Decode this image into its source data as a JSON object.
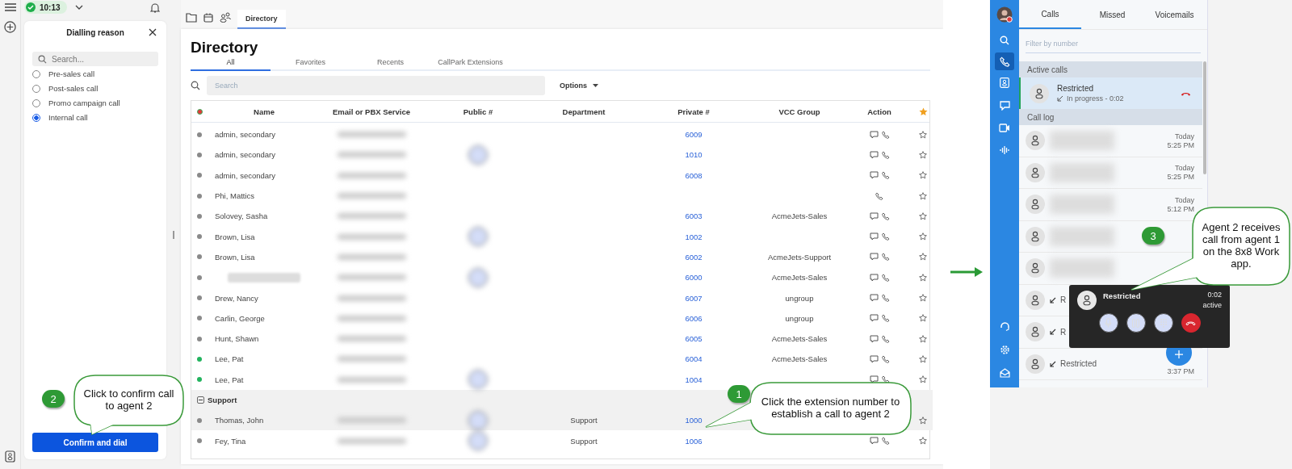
{
  "top_bar": {
    "status_time": "10:13"
  },
  "dialling_panel": {
    "title": "Dialling reason",
    "search": {
      "placeholder": "Search..."
    },
    "options": [
      {
        "label": "Pre-sales call",
        "selected": false
      },
      {
        "label": "Post-sales call",
        "selected": false
      },
      {
        "label": "Promo campaign call",
        "selected": false
      },
      {
        "label": "Internal call",
        "selected": true
      }
    ],
    "confirm_button": "Confirm and dial"
  },
  "directory": {
    "tabs": [
      {
        "label": "Directory",
        "selected": true
      }
    ],
    "title": "Directory",
    "filter_tabs": [
      {
        "label": "All",
        "selected": true
      },
      {
        "label": "Favorites",
        "selected": false
      },
      {
        "label": "Recents",
        "selected": false
      },
      {
        "label": "CallPark Extensions",
        "selected": false
      }
    ],
    "search": {
      "placeholder": "Search"
    },
    "options_button": "Options",
    "table": {
      "columns": [
        "Name",
        "Email or PBX Service",
        "Public #",
        "Department",
        "Private #",
        "VCC Group",
        "Action"
      ],
      "rows": [
        {
          "kind": "contact",
          "name": "admin, secondary",
          "color": "#8a8a8a",
          "email_blurred": true,
          "public_blurred": false,
          "private": "6009",
          "actions": {
            "chat": true,
            "call": true
          },
          "selected": false
        },
        {
          "kind": "contact",
          "name": "admin, secondary",
          "color": "#8a8a8a",
          "email_blurred": true,
          "public_blurred": true,
          "private": "1010",
          "actions": {
            "chat": true,
            "call": true
          },
          "selected": false
        },
        {
          "kind": "contact",
          "name": "admin, secondary",
          "color": "#8a8a8a",
          "email_blurred": true,
          "public_blurred": false,
          "private": "6008",
          "actions": {
            "chat": true,
            "call": true
          },
          "selected": false
        },
        {
          "kind": "contact",
          "name": "Phi, Mattics",
          "color": "#8a8a8a",
          "email_blurred": true,
          "public_blurred": false,
          "actions": {
            "chat": false,
            "call": true
          },
          "selected": false
        },
        {
          "kind": "contact",
          "name": "Solovey, Sasha",
          "color": "#8a8a8a",
          "email_blurred": true,
          "public_blurred": false,
          "private": "6003",
          "vcc_group": "AcmeJets-Sales",
          "actions": {
            "chat": true,
            "call": true
          },
          "selected": false
        },
        {
          "kind": "contact",
          "name": "Brown, Lisa",
          "color": "#8a8a8a",
          "email_blurred": true,
          "public_blurred": true,
          "private": "1002",
          "actions": {
            "chat": true,
            "call": true
          },
          "selected": false
        },
        {
          "kind": "contact",
          "name": "Brown, Lisa",
          "color": "#8a8a8a",
          "email_blurred": true,
          "public_blurred": false,
          "private": "6002",
          "vcc_group": "AcmeJets-Support",
          "actions": {
            "chat": true,
            "call": true
          },
          "selected": false
        },
        {
          "kind": "contact",
          "name_blurred": true,
          "color": "#8a8a8a",
          "email_blurred": true,
          "public_blurred": true,
          "private": "6000",
          "vcc_group": "AcmeJets-Sales",
          "actions": {
            "chat": true,
            "call": true
          },
          "selected": false
        },
        {
          "kind": "contact",
          "name": "Drew, Nancy",
          "color": "#8a8a8a",
          "email_blurred": true,
          "public_blurred": false,
          "private": "6007",
          "vcc_group": "ungroup",
          "actions": {
            "chat": true,
            "call": true
          },
          "selected": false
        },
        {
          "kind": "contact",
          "name": "Carlin, George",
          "color": "#8a8a8a",
          "email_blurred": true,
          "public_blurred": false,
          "private": "6006",
          "vcc_group": "ungroup",
          "actions": {
            "chat": true,
            "call": true
          },
          "selected": false
        },
        {
          "kind": "contact",
          "name": "Hunt, Shawn",
          "color": "#8a8a8a",
          "email_blurred": true,
          "public_blurred": false,
          "private": "6005",
          "vcc_group": "AcmeJets-Sales",
          "actions": {
            "chat": true,
            "call": true
          },
          "selected": false
        },
        {
          "kind": "contact",
          "name": "Lee, Pat",
          "color": "#22b35e",
          "email_blurred": true,
          "public_blurred": false,
          "private": "6004",
          "vcc_group": "AcmeJets-Sales",
          "actions": {
            "chat": true,
            "call": true
          },
          "selected": false
        },
        {
          "kind": "contact",
          "name": "Lee, Pat",
          "color": "#22b35e",
          "email_blurred": true,
          "public_blurred": true,
          "private": "1004",
          "actions": {
            "chat": true,
            "call": true
          },
          "selected": false
        },
        {
          "kind": "group",
          "name": "Support",
          "expanded": true
        },
        {
          "kind": "contact",
          "name": "Thomas, John",
          "color": "#8a8a8a",
          "email_blurred": true,
          "public_blurred": true,
          "department": "Support",
          "private": "1000",
          "actions": {
            "chat": false,
            "call": false
          },
          "selected": true
        },
        {
          "kind": "contact",
          "name": "Fey, Tina",
          "color": "#8a8a8a",
          "email_blurred": true,
          "public_blurred": true,
          "department": "Support",
          "private": "1006",
          "actions": {
            "chat": true,
            "call": true
          },
          "selected": false
        }
      ]
    }
  },
  "work_app": {
    "tabs": [
      {
        "label": "Calls",
        "selected": true
      },
      {
        "label": "Missed",
        "selected": false
      },
      {
        "label": "Voicemails",
        "selected": false
      }
    ],
    "filter": {
      "placeholder": "Filter by number"
    },
    "active_calls_label": "Active calls",
    "active_call": {
      "name": "Restricted",
      "status": "In progress - 0:02"
    },
    "call_log_label": "Call log",
    "call_log": [
      {
        "name_blurred": true,
        "day": "Today",
        "time": "5:25 PM"
      },
      {
        "name_blurred": true,
        "day": "Today",
        "time": "5:25 PM"
      },
      {
        "name_blurred": true,
        "day": "Today",
        "time": "5:12 PM"
      },
      {
        "name_blurred": true
      },
      {
        "name_blurred": true
      },
      {
        "name": "R",
        "incoming": true
      },
      {
        "name": "R",
        "incoming": true
      },
      {
        "name": "Restricted",
        "incoming": true,
        "time": "3:37 PM"
      }
    ],
    "call_popup": {
      "name": "Restricted",
      "duration": "0:02",
      "state": "active"
    }
  },
  "callouts": [
    {
      "number": "2",
      "text": "Click to confirm call to agent 2"
    },
    {
      "number": "1",
      "text": "Click the extension number to establish a call to agent 2"
    },
    {
      "number": "3",
      "text": "Agent 2 receives call from agent 1 on the 8x8 Work app."
    }
  ]
}
